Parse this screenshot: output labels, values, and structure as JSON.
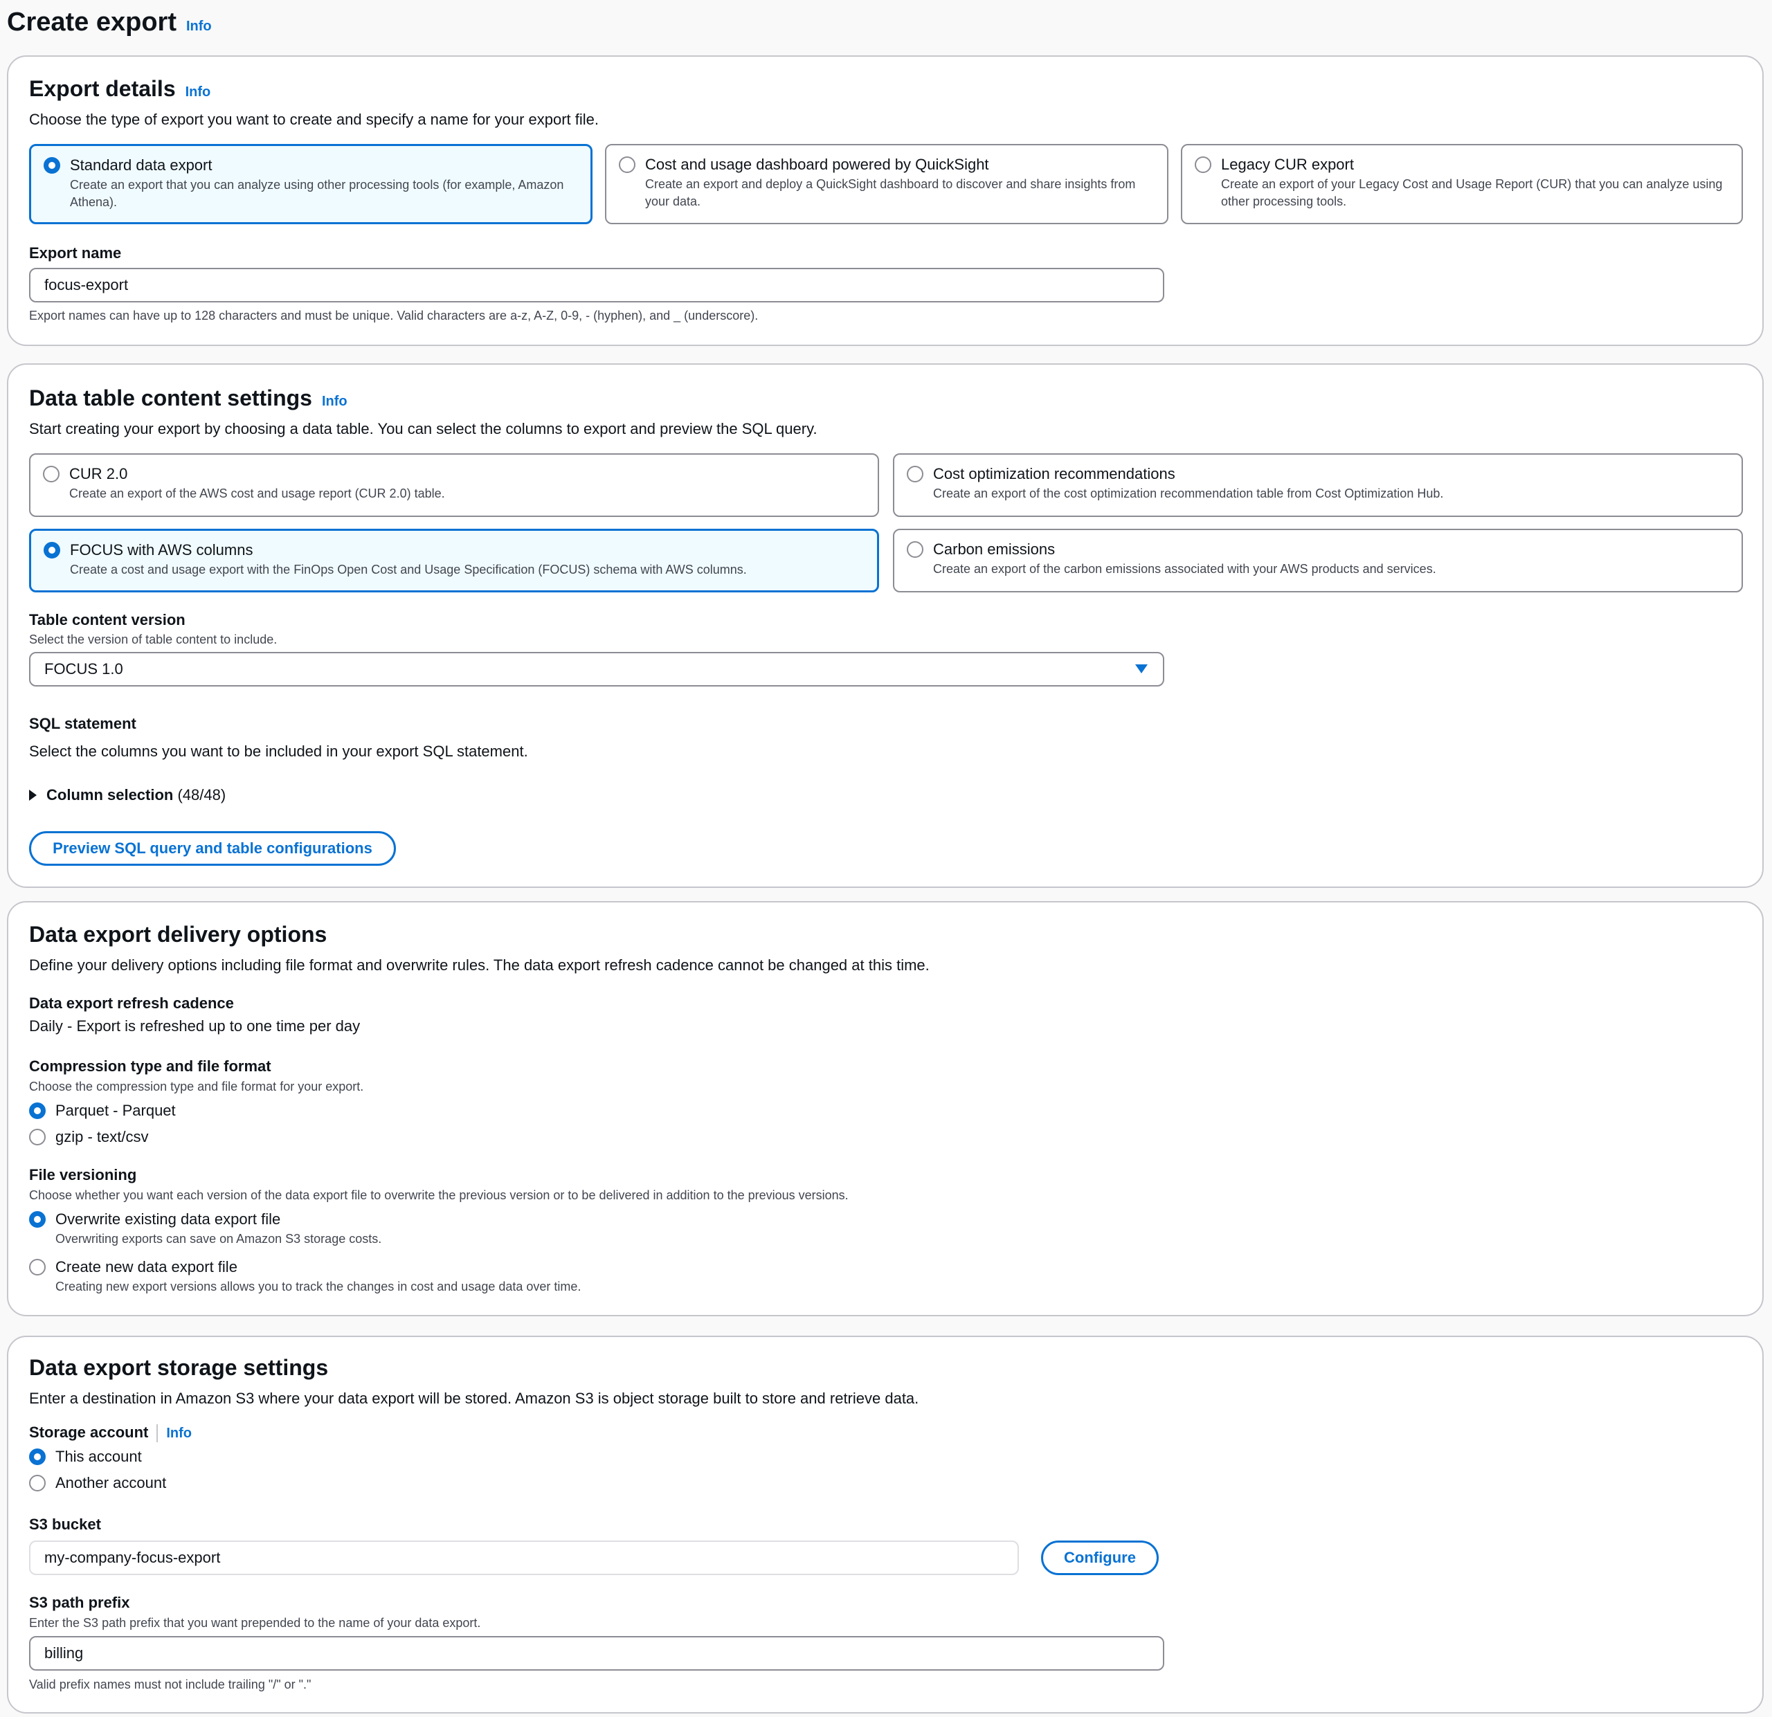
{
  "page": {
    "title": "Create export",
    "info": "Info"
  },
  "export_details": {
    "heading": "Export details",
    "info": "Info",
    "description": "Choose the type of export you want to create and specify a name for your export file.",
    "types": [
      {
        "title": "Standard data export",
        "description": "Create an export that you can analyze using other processing tools (for example, Amazon Athena).",
        "selected": true
      },
      {
        "title": "Cost and usage dashboard powered by QuickSight",
        "description": "Create an export and deploy a QuickSight dashboard to discover and share insights from your data.",
        "selected": false
      },
      {
        "title": "Legacy CUR export",
        "description": "Create an export of your Legacy Cost and Usage Report (CUR) that you can analyze using other processing tools.",
        "selected": false
      }
    ],
    "name_label": "Export name",
    "name_value": "focus-export",
    "name_hint": "Export names can have up to 128 characters and must be unique. Valid characters are a-z, A-Z, 0-9, - (hyphen), and _ (underscore)."
  },
  "data_table": {
    "heading": "Data table content settings",
    "info": "Info",
    "description": "Start creating your export by choosing a data table. You can select the columns to export and preview the SQL query.",
    "tables": [
      {
        "title": "CUR 2.0",
        "description": "Create an export of the AWS cost and usage report (CUR 2.0) table.",
        "selected": false
      },
      {
        "title": "Cost optimization recommendations",
        "description": "Create an export of the cost optimization recommendation table from Cost Optimization Hub.",
        "selected": false
      },
      {
        "title": "FOCUS with AWS columns",
        "description": "Create a cost and usage export with the FinOps Open Cost and Usage Specification (FOCUS) schema with AWS columns.",
        "selected": true
      },
      {
        "title": "Carbon emissions",
        "description": "Create an export of the carbon emissions associated with your AWS products and services.",
        "selected": false
      }
    ],
    "version_label": "Table content version",
    "version_hint": "Select the version of table content to include.",
    "version_value": "FOCUS 1.0",
    "sql_label": "SQL statement",
    "sql_description": "Select the columns you want to be included in your export SQL statement.",
    "column_selection_label": "Column selection",
    "column_selection_count": "(48/48)",
    "preview_button": "Preview SQL query and table configurations"
  },
  "delivery": {
    "heading": "Data export delivery options",
    "description": "Define your delivery options including file format and overwrite rules. The data export refresh cadence cannot be changed at this time.",
    "cadence_label": "Data export refresh cadence",
    "cadence_value": "Daily - Export is refreshed up to one time per day",
    "compression_label": "Compression type and file format",
    "compression_hint": "Choose the compression type and file format for your export.",
    "compression_options": [
      {
        "label": "Parquet - Parquet",
        "selected": true
      },
      {
        "label": "gzip - text/csv",
        "selected": false
      }
    ],
    "versioning_label": "File versioning",
    "versioning_hint": "Choose whether you want each version of the data export file to overwrite the previous version or to be delivered in addition to the previous versions.",
    "versioning_options": [
      {
        "label": "Overwrite existing data export file",
        "description": "Overwriting exports can save on Amazon S3 storage costs.",
        "selected": true
      },
      {
        "label": "Create new data export file",
        "description": "Creating new export versions allows you to track the changes in cost and usage data over time.",
        "selected": false
      }
    ]
  },
  "storage": {
    "heading": "Data export storage settings",
    "description": "Enter a destination in Amazon S3 where your data export will be stored. Amazon S3 is object storage built to store and retrieve data.",
    "account_label": "Storage account",
    "info": "Info",
    "account_options": [
      {
        "label": "This account",
        "selected": true
      },
      {
        "label": "Another account",
        "selected": false
      }
    ],
    "bucket_label": "S3 bucket",
    "bucket_value": "my-company-focus-export",
    "configure_button": "Configure",
    "prefix_label": "S3 path prefix",
    "prefix_hint": "Enter the S3 path prefix that you want prepended to the name of your data export.",
    "prefix_value": "billing",
    "prefix_footer": "Valid prefix names must not include trailing \"/\" or \".\""
  }
}
